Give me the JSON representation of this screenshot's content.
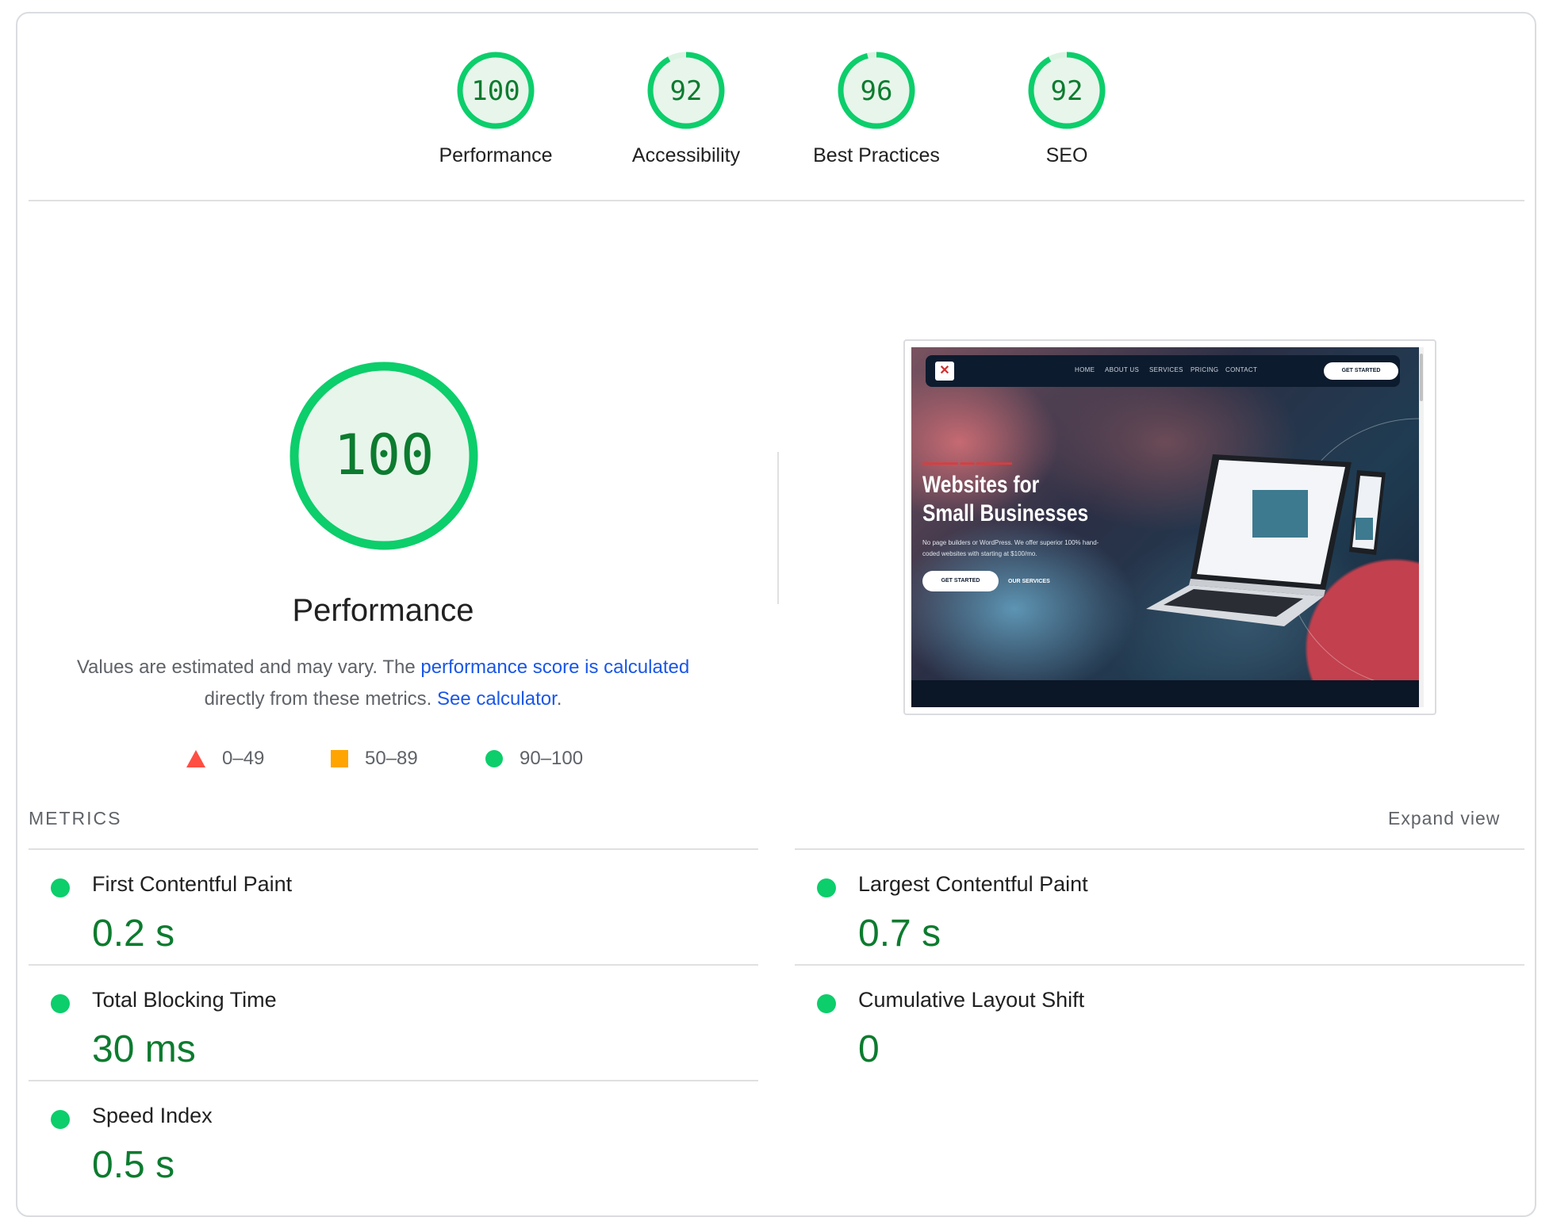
{
  "gauges": [
    {
      "score": "100",
      "label": "Performance"
    },
    {
      "score": "92",
      "label": "Accessibility"
    },
    {
      "score": "96",
      "label": "Best Practices"
    },
    {
      "score": "92",
      "label": "SEO"
    }
  ],
  "performance": {
    "score": "100",
    "title": "Performance",
    "desc_before": "Values are estimated and may vary. The ",
    "desc_link1": "performance score is calculated",
    "desc_middle": " directly from these metrics. ",
    "desc_link2": "See calculator",
    "desc_after": "."
  },
  "legend": {
    "fail": "0–49",
    "average": "50–89",
    "pass": "90–100"
  },
  "screenshot": {
    "nav_links": [
      "HOME",
      "ABOUT US",
      "SERVICES",
      "PRICING",
      "CONTACT"
    ],
    "nav_cta": "GET STARTED",
    "hero_title": "Websites for Small Businesses",
    "hero_sub": "No page builders or WordPress. We offer superior 100% hand-coded websites with starting at $100/mo.",
    "hero_button": "GET STARTED",
    "hero_link": "OUR SERVICES"
  },
  "metrics": {
    "heading": "METRICS",
    "expand": "Expand view",
    "items": [
      {
        "name": "First Contentful Paint",
        "value": "0.2 s"
      },
      {
        "name": "Largest Contentful Paint",
        "value": "0.7 s"
      },
      {
        "name": "Total Blocking Time",
        "value": "30 ms"
      },
      {
        "name": "Cumulative Layout Shift",
        "value": "0"
      },
      {
        "name": "Speed Index",
        "value": "0.5 s"
      }
    ]
  },
  "colors": {
    "pass": "#0cce6b",
    "pass_text": "#0c7b2f",
    "gauge_fill": "#e6f7ea",
    "average": "#ffa400",
    "fail": "#ff4e42",
    "link": "#1a57e8"
  }
}
